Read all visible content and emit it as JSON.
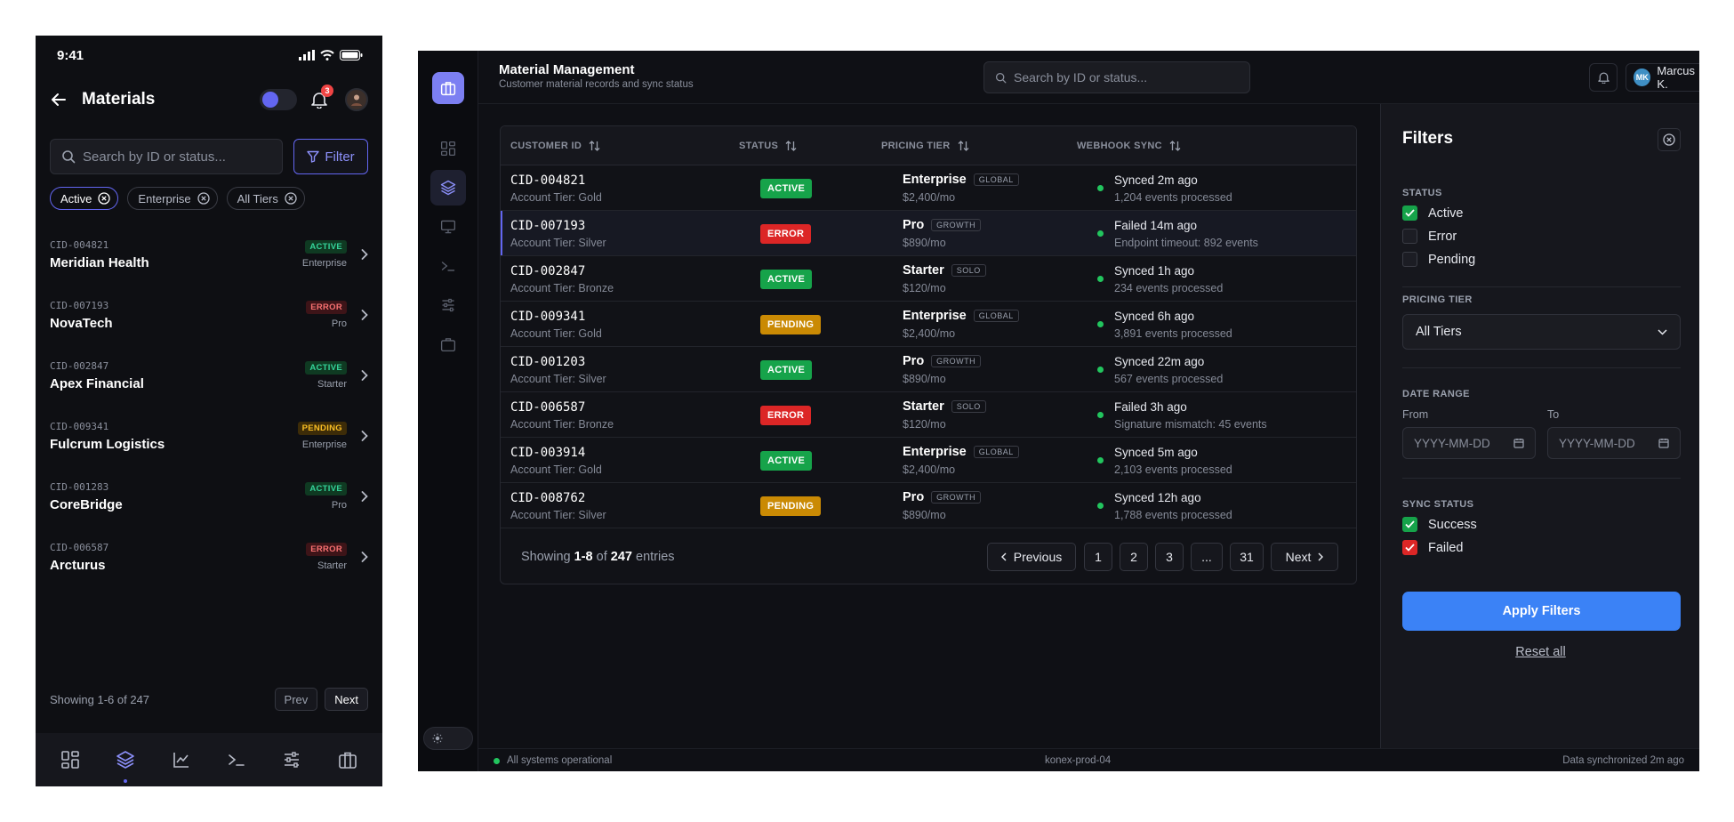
{
  "mobile": {
    "status_time": "9:41",
    "title": "Materials",
    "notification_count": "3",
    "search_placeholder": "Search by ID or status...",
    "filter_label": "Filter",
    "chips": [
      {
        "label": "Active",
        "active": true
      },
      {
        "label": "Enterprise",
        "active": false
      },
      {
        "label": "All Tiers",
        "active": false
      }
    ],
    "items": [
      {
        "cid": "CID-004821",
        "name": "Meridian Health",
        "status": "ACTIVE",
        "tier": "Enterprise"
      },
      {
        "cid": "CID-007193",
        "name": "NovaTech",
        "status": "ERROR",
        "tier": "Pro"
      },
      {
        "cid": "CID-002847",
        "name": "Apex Financial",
        "status": "ACTIVE",
        "tier": "Starter"
      },
      {
        "cid": "CID-009341",
        "name": "Fulcrum Logistics",
        "status": "PENDING",
        "tier": "Enterprise"
      },
      {
        "cid": "CID-001283",
        "name": "CoreBridge",
        "status": "ACTIVE",
        "tier": "Pro"
      },
      {
        "cid": "CID-006587",
        "name": "Arcturus",
        "status": "ERROR",
        "tier": "Starter"
      }
    ],
    "footer_text": "Showing 1-6 of 247",
    "prev_label": "Prev",
    "next_label": "Next",
    "tabs": [
      "grid-icon",
      "layers-icon",
      "chart-icon",
      "terminal-icon",
      "sliders-icon",
      "briefcase-icon"
    ],
    "active_tab": 1
  },
  "desktop": {
    "title": "Material Management",
    "subtitle": "Customer material records and sync status",
    "search_placeholder": "Search by ID or status...",
    "user_initials": "MK",
    "user_name": "Marcus K.",
    "columns": [
      "CUSTOMER ID",
      "STATUS",
      "PRICING TIER",
      "WEBHOOK SYNC"
    ],
    "rows": [
      {
        "cid": "CID-004821",
        "account": "Account Tier: Gold",
        "status": "ACTIVE",
        "plan": "Enterprise",
        "tag": "GLOBAL",
        "price": "$2,400/mo",
        "sync": "Synced 2m ago",
        "events": "1,204 events processed"
      },
      {
        "cid": "CID-007193",
        "account": "Account Tier: Silver",
        "status": "ERROR",
        "plan": "Pro",
        "tag": "GROWTH",
        "price": "$890/mo",
        "sync": "Failed 14m ago",
        "events": "Endpoint timeout: 892 events"
      },
      {
        "cid": "CID-002847",
        "account": "Account Tier: Bronze",
        "status": "ACTIVE",
        "plan": "Starter",
        "tag": "SOLO",
        "price": "$120/mo",
        "sync": "Synced 1h ago",
        "events": "234 events processed"
      },
      {
        "cid": "CID-009341",
        "account": "Account Tier: Gold",
        "status": "PENDING",
        "plan": "Enterprise",
        "tag": "GLOBAL",
        "price": "$2,400/mo",
        "sync": "Synced 6h ago",
        "events": "3,891 events processed"
      },
      {
        "cid": "CID-001203",
        "account": "Account Tier: Silver",
        "status": "ACTIVE",
        "plan": "Pro",
        "tag": "GROWTH",
        "price": "$890/mo",
        "sync": "Synced 22m ago",
        "events": "567 events processed"
      },
      {
        "cid": "CID-006587",
        "account": "Account Tier: Bronze",
        "status": "ERROR",
        "plan": "Starter",
        "tag": "SOLO",
        "price": "$120/mo",
        "sync": "Failed 3h ago",
        "events": "Signature mismatch: 45 events"
      },
      {
        "cid": "CID-003914",
        "account": "Account Tier: Gold",
        "status": "ACTIVE",
        "plan": "Enterprise",
        "tag": "GLOBAL",
        "price": "$2,400/mo",
        "sync": "Synced 5m ago",
        "events": "2,103 events processed"
      },
      {
        "cid": "CID-008762",
        "account": "Account Tier: Silver",
        "status": "PENDING",
        "plan": "Pro",
        "tag": "GROWTH",
        "price": "$890/mo",
        "sync": "Synced 12h ago",
        "events": "1,788 events processed"
      }
    ],
    "pager": {
      "showing_prefix": "Showing",
      "range": "1-8",
      "of": "of",
      "total": "247",
      "entries": "entries",
      "previous": "Previous",
      "pages": [
        "1",
        "2",
        "3",
        "...",
        "31"
      ],
      "next": "Next"
    },
    "filters": {
      "title": "Filters",
      "status_label": "STATUS",
      "status_options": [
        {
          "label": "Active",
          "checked": true
        },
        {
          "label": "Error",
          "checked": false
        },
        {
          "label": "Pending",
          "checked": false
        }
      ],
      "pricing_label": "PRICING TIER",
      "pricing_value": "All Tiers",
      "date_label": "DATE RANGE",
      "from_label": "From",
      "to_label": "To",
      "date_placeholder": "YYYY-MM-DD",
      "sync_label": "SYNC STATUS",
      "sync_options": [
        {
          "label": "Success",
          "checked": true,
          "color": "#16a34a"
        },
        {
          "label": "Failed",
          "checked": true,
          "color": "#dc2626"
        }
      ],
      "apply_label": "Apply Filters",
      "reset_label": "Reset all"
    },
    "statusbar": {
      "left": "All systems operational",
      "center": "konex-prod-04",
      "right": "Data synchronized 2m ago"
    }
  },
  "colors": {
    "accent": "#6366f1",
    "primary_button": "#3b82f6",
    "active": "#16a34a",
    "error": "#dc2626",
    "pending": "#ca8a04"
  }
}
